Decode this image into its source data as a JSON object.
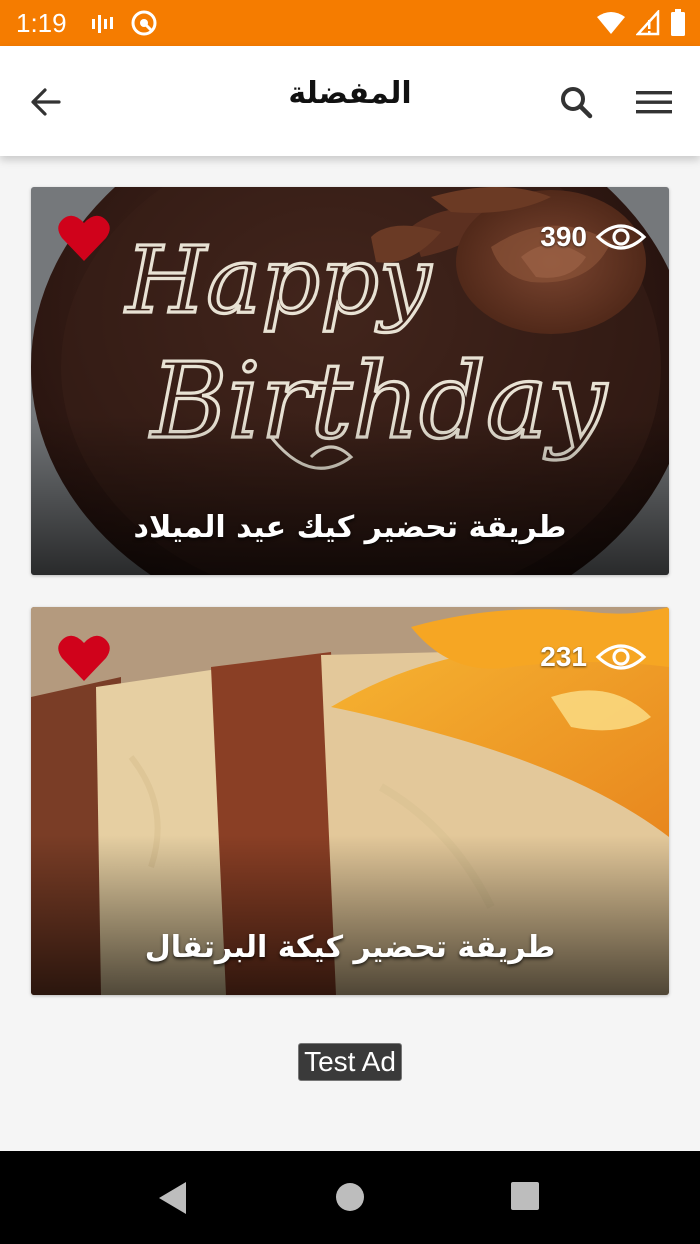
{
  "status_bar": {
    "time": "1:19",
    "icons": [
      "signal-bars-icon",
      "sync-icon",
      "wifi-icon",
      "cell-signal-icon",
      "battery-icon"
    ],
    "color": "#f57c00"
  },
  "app_bar": {
    "title": "المفضلة",
    "icons": [
      "back-arrow-icon",
      "search-icon",
      "hamburger-menu-icon"
    ]
  },
  "recipes": [
    {
      "title": "طريقة تحضير كيك عيد الميلاد",
      "views": "390",
      "favorited": true,
      "image_text_line1": "Happy",
      "image_text_line2": "Birthday"
    },
    {
      "title": "طريقة تحضير كيكة البرتقال",
      "views": "231",
      "favorited": true
    }
  ],
  "ad": {
    "label": "Test Ad"
  },
  "colors": {
    "accent": "#f57c00",
    "heart": "#d0021b",
    "title_text": "#111111"
  },
  "nav_bar": {
    "icons": [
      "nav-back-icon",
      "nav-home-icon",
      "nav-recents-icon"
    ]
  }
}
